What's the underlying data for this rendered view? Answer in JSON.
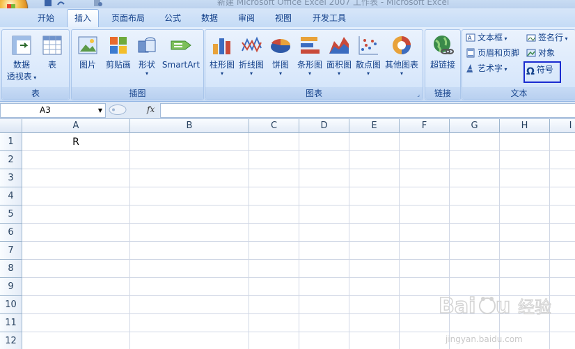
{
  "window": {
    "title": "新建 Microsoft Office Excel 2007 工作表 - Microsoft Excel"
  },
  "tabs": [
    {
      "label": "开始",
      "active": false
    },
    {
      "label": "插入",
      "active": true
    },
    {
      "label": "页面布局",
      "active": false
    },
    {
      "label": "公式",
      "active": false
    },
    {
      "label": "数据",
      "active": false
    },
    {
      "label": "审阅",
      "active": false
    },
    {
      "label": "视图",
      "active": false
    },
    {
      "label": "开发工具",
      "active": false
    }
  ],
  "ribbon": {
    "groups": {
      "table": {
        "label": "表",
        "pivot_line1": "数据",
        "pivot_line2": "透视表",
        "table": "表"
      },
      "illustrations": {
        "label": "插图",
        "picture": "图片",
        "clipart": "剪贴画",
        "shapes": "形状",
        "smartart": "SmartArt"
      },
      "charts": {
        "label": "图表",
        "column": "柱形图",
        "line": "折线图",
        "pie": "饼图",
        "bar": "条形图",
        "area": "面积图",
        "scatter": "散点图",
        "other": "其他图表"
      },
      "links": {
        "label": "链接",
        "hyperlink": "超链接"
      },
      "text": {
        "label": "文本",
        "textbox": "文本框",
        "header_footer": "页眉和页脚",
        "wordart": "艺术字",
        "signature": "签名行",
        "object": "对象",
        "symbol": "符号"
      }
    },
    "highlight_color": "#1a2bd0"
  },
  "formula_bar": {
    "name_box": "A3",
    "fx": "fx",
    "content": ""
  },
  "sheet": {
    "columns": [
      "A",
      "B",
      "C",
      "D",
      "E",
      "F",
      "G",
      "H",
      "I"
    ],
    "rows": [
      "1",
      "2",
      "3",
      "4",
      "5",
      "6",
      "7",
      "8",
      "9",
      "10",
      "11",
      "12"
    ],
    "cells": {
      "A1": "R"
    }
  },
  "watermark": {
    "brand": "Baidu 经验",
    "url": "jingyan.baidu.com"
  },
  "colors": {
    "accent": "#15428b",
    "ribbon_bg": "#dbe8fb",
    "grid_line": "#d0d7e5"
  }
}
